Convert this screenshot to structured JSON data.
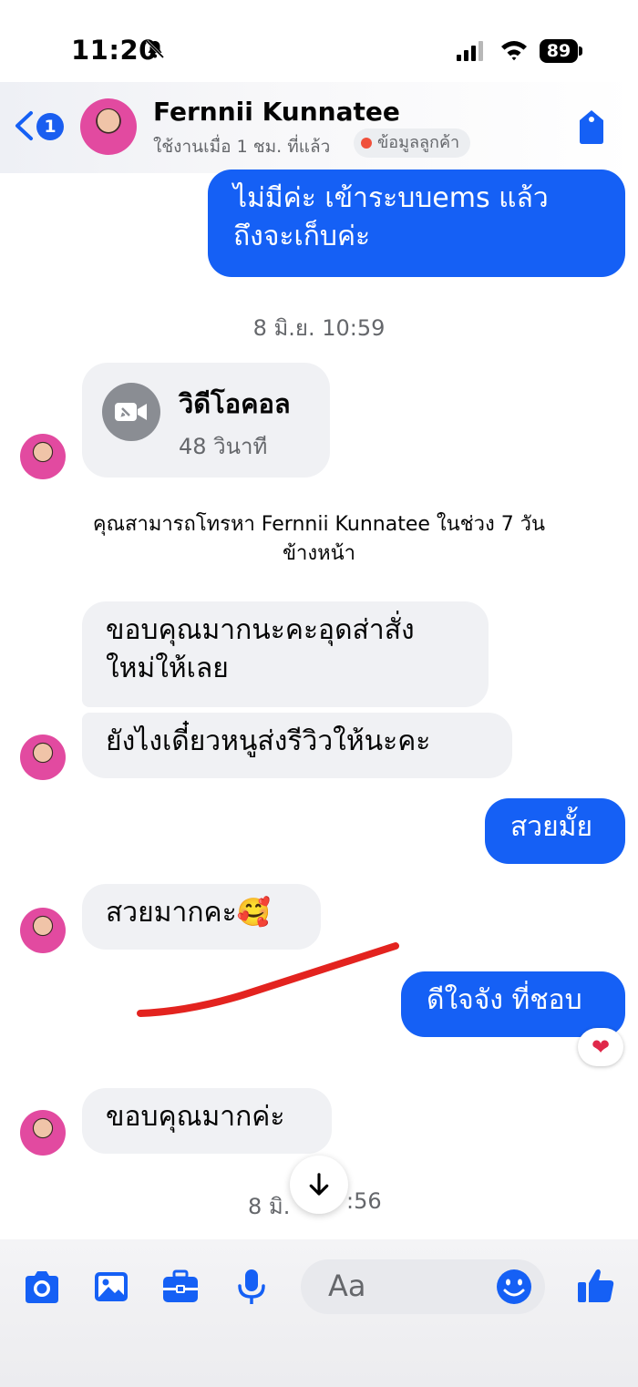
{
  "status_bar": {
    "time": "11:20",
    "battery": "89"
  },
  "header": {
    "back_badge": "1",
    "contact_name": "Fernnii Kunnatee",
    "active_status": "ใช้งานเมื่อ 1 ชม. ที่แล้ว",
    "customer_tag": "ข้อมูลลูกค้า"
  },
  "messages": {
    "m1_line1": "ไม่มีค่ะ เข้าระบบems แล้ว",
    "m1_line2": "ถึงจะเก็บค่ะ",
    "timestamp1": "8 มิ.ย. 10:59",
    "call_title": "วิดีโอคอล",
    "call_duration": "48 วินาที",
    "system_note_line1": "คุณสามารถโทรหา Fernnii Kunnatee ในช่วง 7 วัน",
    "system_note_line2": "ข้างหน้า",
    "m2_line1": "ขอบคุณมากนะคะอุดส่าสั่ง",
    "m2_line2": "ใหม่ให้เลย",
    "m3": "ยังไงเดี๋ยวหนูส่งรีวิวให้นะคะ",
    "m4": "สวยมั้ย",
    "m5": "สวยมากคะ🥰",
    "m6": "ดีใจจัง ที่ชอบ",
    "m6_reaction": "❤",
    "m7": "ขอบคุณมากค่ะ",
    "timestamp2_left": "8 มิ.",
    "timestamp2_right": ":56"
  },
  "composer": {
    "placeholder": "Aa"
  },
  "colors": {
    "accent": "#1560f5",
    "incoming_bubble": "#f0f1f4",
    "annotation_stroke": "#e3231f"
  },
  "icons": [
    "bell-slash-icon",
    "signal-icon",
    "wifi-icon",
    "battery-icon",
    "back-chevron-icon",
    "tag-icon",
    "video-call-icon",
    "heart-icon",
    "arrow-down-icon",
    "camera-icon",
    "image-icon",
    "briefcase-icon",
    "microphone-icon",
    "emoji-icon",
    "thumbs-up-icon"
  ]
}
